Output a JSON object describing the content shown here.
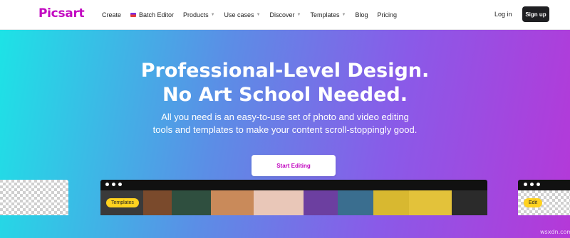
{
  "nav": {
    "logo": "Picsart",
    "items": [
      {
        "label": "Create",
        "dropdown": false
      },
      {
        "label": "Batch Editor",
        "dropdown": false,
        "icon": "batch-editor-icon"
      },
      {
        "label": "Products",
        "dropdown": true
      },
      {
        "label": "Use cases",
        "dropdown": true
      },
      {
        "label": "Discover",
        "dropdown": true
      },
      {
        "label": "Templates",
        "dropdown": true
      },
      {
        "label": "Blog",
        "dropdown": false
      },
      {
        "label": "Pricing",
        "dropdown": false
      }
    ],
    "login": "Log in",
    "signup": "Sign up"
  },
  "hero": {
    "title_line1": "Professional-Level Design.",
    "title_line2": "No Art School Needed.",
    "subtitle_line1": "All you need is an easy-to-use set of photo and video editing",
    "subtitle_line2": "tools and templates to make your content scroll-stoppingly good.",
    "cta": "Start Editing"
  },
  "previews": {
    "center_badge": "Templates",
    "right_badge": "Edit"
  },
  "watermark": "wsxdn.com",
  "colors": {
    "brand": "#c209c1",
    "gradient_start": "#1de3e6",
    "gradient_end": "#b538d8",
    "signup_bg": "#1f1f22",
    "badge": "#ffd21f"
  }
}
